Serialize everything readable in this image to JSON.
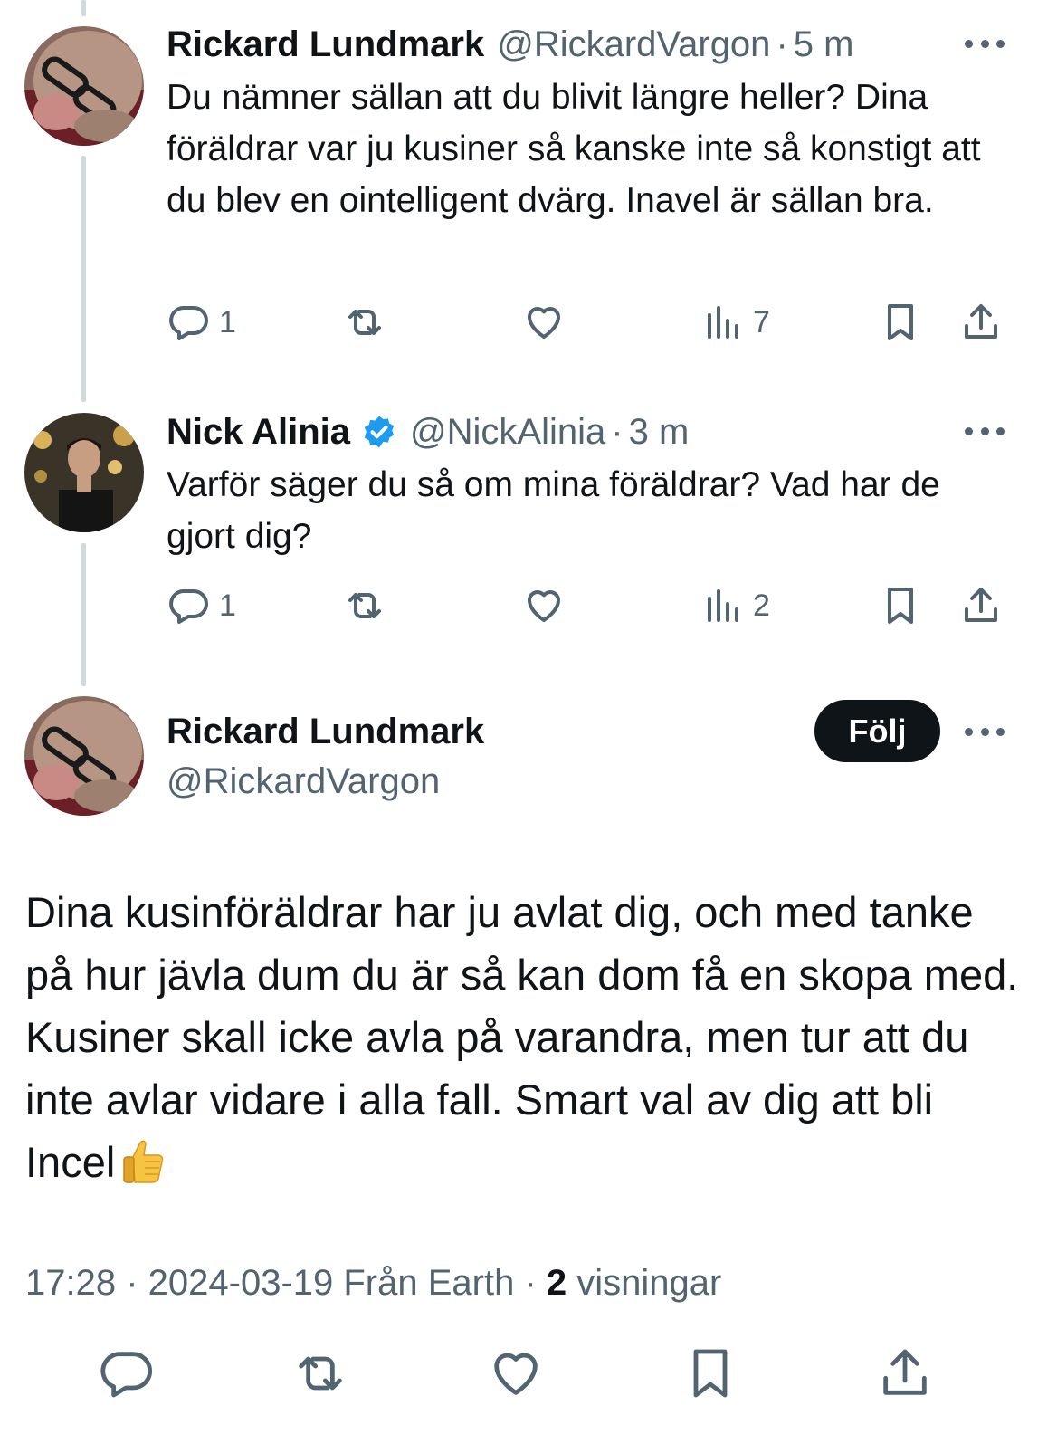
{
  "tweets": [
    {
      "name": "Rickard Lundmark",
      "handle": "@RickardVargon",
      "dot": "·",
      "time": "5 m",
      "text": "Du nämner sällan att du blivit längre heller? Dina föräldrar var ju kusiner så kanske inte så konstigt att du blev en ointelligent dvärg. Inavel är sällan bra.",
      "replies": "1",
      "views": "7",
      "verified": false
    },
    {
      "name": "Nick Alinia",
      "handle": "@NickAlinia",
      "dot": "·",
      "time": "3 m",
      "text": "Varför säger du så om mina föräldrar? Vad har de gjort dig?",
      "replies": "1",
      "views": "2",
      "verified": true
    }
  ],
  "main": {
    "name": "Rickard Lundmark",
    "handle": "@RickardVargon",
    "follow_label": "Följ",
    "text": "Dina kusinföräldrar har ju avlat dig, och med tanke på hur jävla dum du är så kan dom få en skopa med. Kusiner skall icke avla på varandra, men tur att du inte avlar vidare i alla fall. Smart val av dig att bli Incel",
    "emoji": "thumbs-up",
    "meta_prefix": "17:28 · 2024-03-19 Från Earth · ",
    "views_count": "2",
    "views_label": " visningar"
  },
  "icons": {
    "reply": "reply-icon",
    "retweet": "retweet-icon",
    "like": "heart-icon",
    "views": "views-icon",
    "bookmark": "bookmark-icon",
    "share": "share-icon",
    "more": "more-icon",
    "verified": "verified-badge-icon"
  },
  "colors": {
    "text": "#0f1419",
    "secondary": "#536471",
    "verified": "#1d9bf0",
    "thread_line": "#cfd9de",
    "follow_bg": "#0f1419"
  }
}
